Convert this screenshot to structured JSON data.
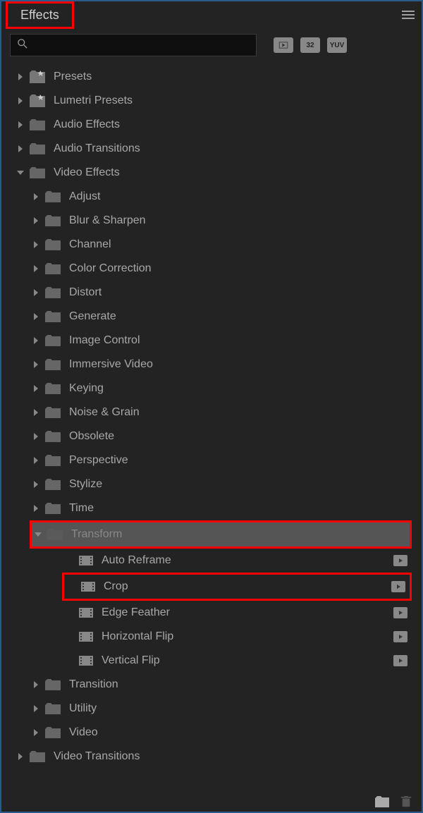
{
  "header": {
    "tab_label": "Effects"
  },
  "filter_icons": {
    "accelerated": "▶",
    "bit32": "32",
    "yuv": "YUV"
  },
  "tree": {
    "presets": "Presets",
    "lumetri_presets": "Lumetri Presets",
    "audio_effects": "Audio Effects",
    "audio_transitions": "Audio Transitions",
    "video_effects": "Video Effects",
    "ve_children": {
      "adjust": "Adjust",
      "blur_sharpen": "Blur & Sharpen",
      "channel": "Channel",
      "color_correction": "Color Correction",
      "distort": "Distort",
      "generate": "Generate",
      "image_control": "Image Control",
      "immersive_video": "Immersive Video",
      "keying": "Keying",
      "noise_grain": "Noise & Grain",
      "obsolete": "Obsolete",
      "perspective": "Perspective",
      "stylize": "Stylize",
      "time": "Time",
      "transform": "Transform",
      "transform_children": {
        "auto_reframe": "Auto Reframe",
        "crop": "Crop",
        "edge_feather": "Edge Feather",
        "horizontal_flip": "Horizontal Flip",
        "vertical_flip": "Vertical Flip"
      },
      "transition": "Transition",
      "utility": "Utility",
      "video": "Video"
    },
    "video_transitions": "Video Transitions"
  }
}
